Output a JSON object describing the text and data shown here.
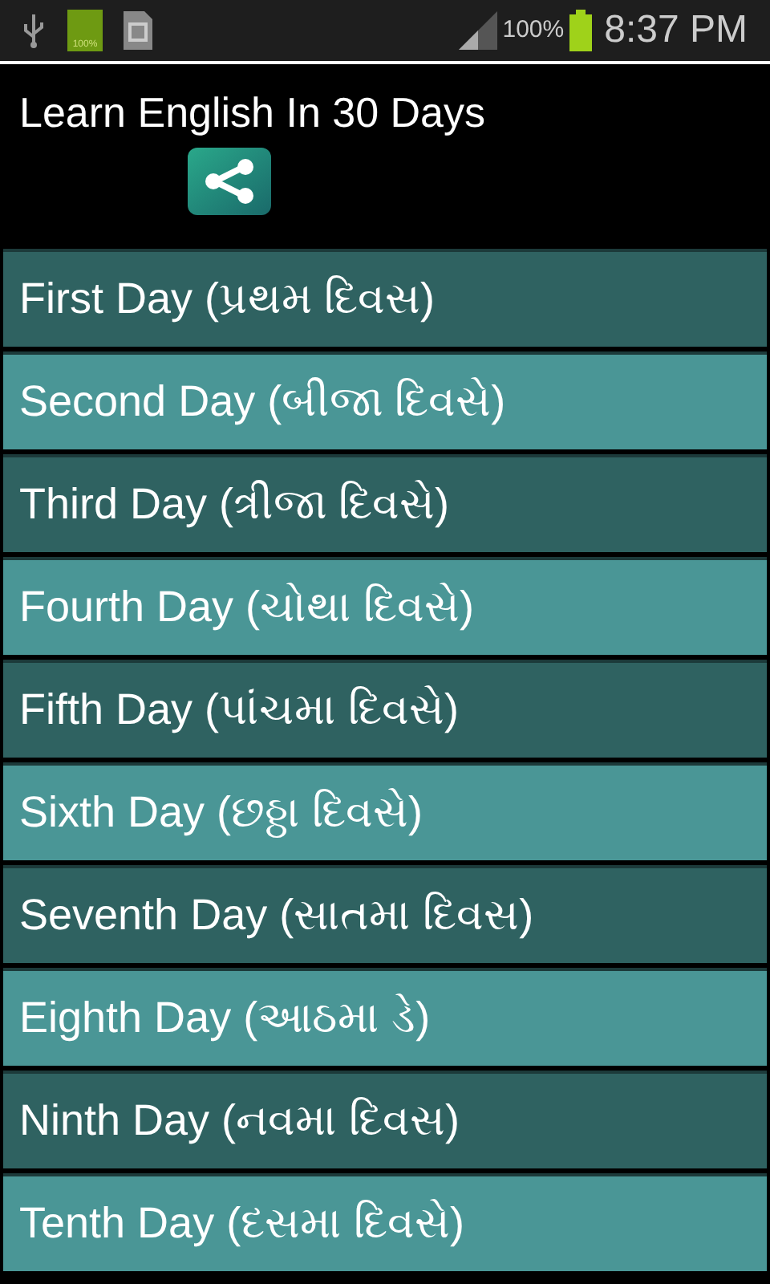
{
  "status_bar": {
    "battery_badge": "100%",
    "battery_percent": "100%",
    "time": "8:37 PM"
  },
  "header": {
    "title": "Learn English In 30 Days"
  },
  "days": [
    {
      "label": "First Day (પ્રથમ દિવસ)"
    },
    {
      "label": "Second Day (બીજા દિવસે)"
    },
    {
      "label": "Third Day (ત્રીજા દિવસે)"
    },
    {
      "label": "Fourth Day (ચોથા દિવસે)"
    },
    {
      "label": "Fifth Day (પાંચમા દિવસે)"
    },
    {
      "label": "Sixth Day (છઠ્ઠા દિવસે)"
    },
    {
      "label": "Seventh Day (સાતમા દિવસ)"
    },
    {
      "label": "Eighth Day (આઠમા ડે)"
    },
    {
      "label": "Ninth Day (નવમા દિવસ)"
    },
    {
      "label": "Tenth Day (દસમા દિવસે)"
    }
  ]
}
